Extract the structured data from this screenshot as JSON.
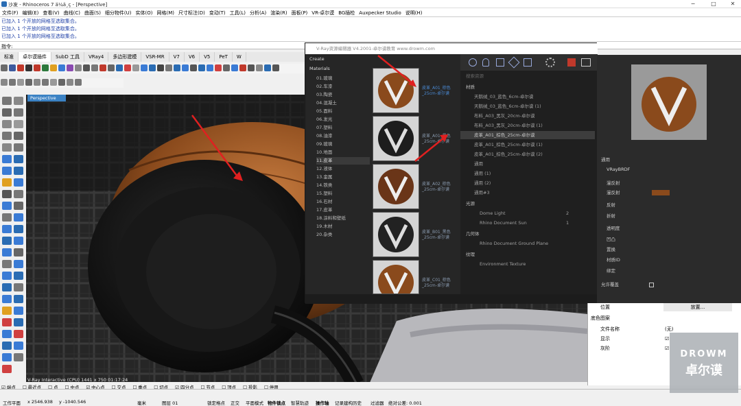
{
  "window": {
    "title": "沙发 - Rhinoceros 7 ä¼ä¸ç - [Perspective]",
    "min": "−",
    "max": "□",
    "close": "✕"
  },
  "menu": [
    "文件(F)",
    "编辑(E)",
    "查看(V)",
    "曲线(C)",
    "曲面(S)",
    "细分物件(U)",
    "实体(O)",
    "网格(M)",
    "尺寸标注(D)",
    "变动(T)",
    "工具(L)",
    "分析(A)",
    "渲染(R)",
    "面板(P)",
    "VR-卓尔谟",
    "BG插检",
    "Auxpecker Studio",
    "说明(H)"
  ],
  "history": [
    "已加入 1 个开放的网格至选取集合。",
    "已加入 1 个开放的网格至选取集合。",
    "已加入 1 个开放的网格至选取集合。"
  ],
  "command_prompt": "指令:",
  "toolbar_tabs": [
    "标准",
    "卓尔谟插件",
    "SubD 工具",
    "VRay4",
    "多边形建模",
    "VSR-MR",
    "V7",
    "V6",
    "V5",
    "PeT",
    "W"
  ],
  "viewport": {
    "label": "Perspective",
    "status": "V-Ray Interactive (CPU)  1441 x 750  01:17:24"
  },
  "vray": {
    "title": "V-Ray资源编辑器 V4.2001-卓尔谟教育 www.drowm.com",
    "create": "Create",
    "materials_heading": "Materials",
    "categories": [
      "01.玻璃",
      "02.车漆",
      "03.陶瓷",
      "04.混凝土",
      "05.面料",
      "06.发光",
      "07.塑料",
      "08.油漆",
      "09.玻璃",
      "10.地面",
      "11.皮革",
      "12.液体",
      "13.金属",
      "14.铁类",
      "15.塑料",
      "16.石材",
      "17.皮革",
      "18.涂料和壁纸",
      "19.木材",
      "20.杂类"
    ],
    "selected_category": "11.皮革",
    "thumbs": [
      "皮革_A01_棕色_25cm-卓尔谟",
      "皮革_A01_黑色_25cm-卓尔谟",
      "皮革_A02_棕色_25cm-卓尔谟",
      "皮革_B01_黑色_25cm-卓尔谟",
      "皮革_C01_棕色_25cm-卓尔谟"
    ],
    "search_placeholder": "搜索资源",
    "sec_materials": "材质",
    "mat_list": [
      "天鹅绒_03_蓝色_6cm-卓尔谟",
      "天鹅绒_03_蓝色_6cm-卓尔谟 (1)",
      "布料_A03_黑灰_20cm-卓尔谟",
      "布料_A03_黑灰_20cm-卓尔谟 (1)",
      "皮革_A01_棕色_25cm-卓尔谟",
      "皮革_A01_棕色_25cm-卓尔谟 (1)",
      "皮革_A01_棕色_25cm-卓尔谟 (2)",
      "通用",
      "通用 (1)",
      "通用 (2)",
      "通用#3"
    ],
    "selected_mat": "皮革_A01_棕色_25cm-卓尔谟",
    "sec_lights": "光源",
    "lights": [
      {
        "name": "Dome Light",
        "count": "2"
      },
      {
        "name": "Rhino Document Sun",
        "count": "1"
      }
    ],
    "sec_geometry": "几何体",
    "geometry": [
      "Rhino Document Ground Plane"
    ],
    "sec_textures": "纹理",
    "textures": [
      "Environment Texture"
    ]
  },
  "right_panel": {
    "general": "通用",
    "brdf": "VRayBRDF",
    "diffuse": "漫反射",
    "diffuse_label": "漫反射",
    "reflection": "反射",
    "refraction": "折射",
    "opacity": "透明度",
    "bump": "凹凸",
    "displacement": "置换",
    "material_id": "材质ID",
    "binding": "绑定",
    "allow_override": "允许覆盖"
  },
  "properties": {
    "position": "位置",
    "place_btn": "放置...",
    "bg_image": "底色图案",
    "filename_label": "文件名称",
    "filename_value": "(无)",
    "show_label": "显示",
    "gray_label": "灰阶"
  },
  "snaps": [
    "端点",
    "最近点",
    "点",
    "中点",
    "中心点",
    "交点",
    "垂点",
    "切点",
    "四分点",
    "节点",
    "顶点",
    "投影",
    "停用"
  ],
  "status": {
    "plane": "工作平面",
    "x": "x 2546.938",
    "y": "y -1040.546",
    "unit": "毫米",
    "layer": "图层 01",
    "grid_snap": "锁定格点",
    "ortho": "正交",
    "planar": "平面模式",
    "osnap": "物件锁点",
    "smarttrack": "智慧轨迹",
    "gumball": "操作轴",
    "history": "记录建构历史",
    "filter": "过滤器",
    "tolerance": "绝对公差: 0.001"
  },
  "watermark": {
    "top": "DROWM",
    "bottom": "卓尔谟"
  },
  "colors": {
    "accent": "#3b82c4",
    "leather": "#8a4a1c",
    "vray_bg": "#2b2b2b"
  }
}
